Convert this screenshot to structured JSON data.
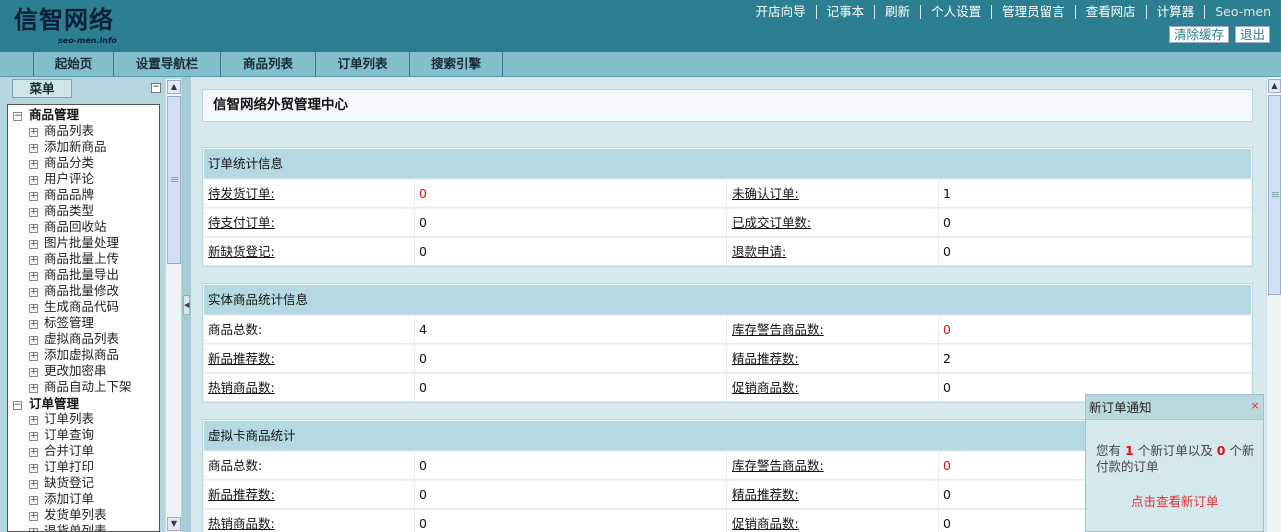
{
  "header": {
    "logo_cn": "信智网络",
    "logo_en": "seo-men.info",
    "top_links": [
      "开店向导",
      "记事本",
      "刷新",
      "个人设置",
      "管理员留言",
      "查看网店",
      "计算器",
      "Seo-men"
    ],
    "clear_cache": "清除缓存",
    "logout": "退出"
  },
  "nav": {
    "tabs": [
      "起始页",
      "设置导航栏",
      "商品列表",
      "订单列表",
      "搜索引擎"
    ]
  },
  "sidebar": {
    "menu_label": "菜单",
    "collapse_icon": "minus-icon",
    "groups": [
      {
        "label": "商品管理",
        "items": [
          "商品列表",
          "添加新商品",
          "商品分类",
          "用户评论",
          "商品品牌",
          "商品类型",
          "商品回收站",
          "图片批量处理",
          "商品批量上传",
          "商品批量导出",
          "商品批量修改",
          "生成商品代码",
          "标签管理",
          "虚拟商品列表",
          "添加虚拟商品",
          "更改加密串",
          "商品自动上下架"
        ]
      },
      {
        "label": "订单管理",
        "items": [
          "订单列表",
          "订单查询",
          "合并订单",
          "订单打印",
          "缺货登记",
          "添加订单",
          "发货单列表",
          "退货单列表"
        ]
      }
    ]
  },
  "main": {
    "title": "信智网络外贸管理中心",
    "order_panel": {
      "title": "订单统计信息",
      "rows": [
        {
          "l1": "待发货订单:",
          "v1": "0",
          "l2": "未确认订单:",
          "v2": "1"
        },
        {
          "l1": "待支付订单:",
          "v1": "0",
          "l2": "已成交订单数:",
          "v2": "0"
        },
        {
          "l1": "新缺货登记:",
          "v1": "0",
          "l2": "退款申请:",
          "v2": "0"
        }
      ]
    },
    "goods_panel": {
      "title": "实体商品统计信息",
      "rows": [
        {
          "l1": "商品总数:",
          "v1": "4",
          "l2": "库存警告商品数:",
          "v2": "0"
        },
        {
          "l1": "新品推荐数:",
          "v1": "0",
          "l2": "精品推荐数:",
          "v2": "2"
        },
        {
          "l1": "热销商品数:",
          "v1": "0",
          "l2": "促销商品数:",
          "v2": "0"
        }
      ]
    },
    "virtual_panel": {
      "title": "虚拟卡商品统计",
      "rows": [
        {
          "l1": "商品总数:",
          "v1": "0",
          "l2": "库存警告商品数:",
          "v2": "0"
        },
        {
          "l1": "新品推荐数:",
          "v1": "0",
          "l2": "精品推荐数:",
          "v2": "0"
        },
        {
          "l1": "热销商品数:",
          "v1": "0",
          "l2": "促销商品数:",
          "v2": "0"
        }
      ]
    }
  },
  "notify": {
    "title": "新订单通知",
    "close": "×",
    "msg_a": "您有",
    "new_orders": "1",
    "msg_b": "个新订单以及",
    "new_paid": "0",
    "msg_c": "个新付款的订单",
    "link": "点击查看新订单"
  },
  "colors": {
    "header_bg": "#2b7f91",
    "nav_bg": "#82bfcc",
    "sidebar_bg": "#b5d8e0",
    "main_bg": "#d5e9ee",
    "panel_header": "#b5d9e2",
    "alert_red": "#dd1111"
  }
}
